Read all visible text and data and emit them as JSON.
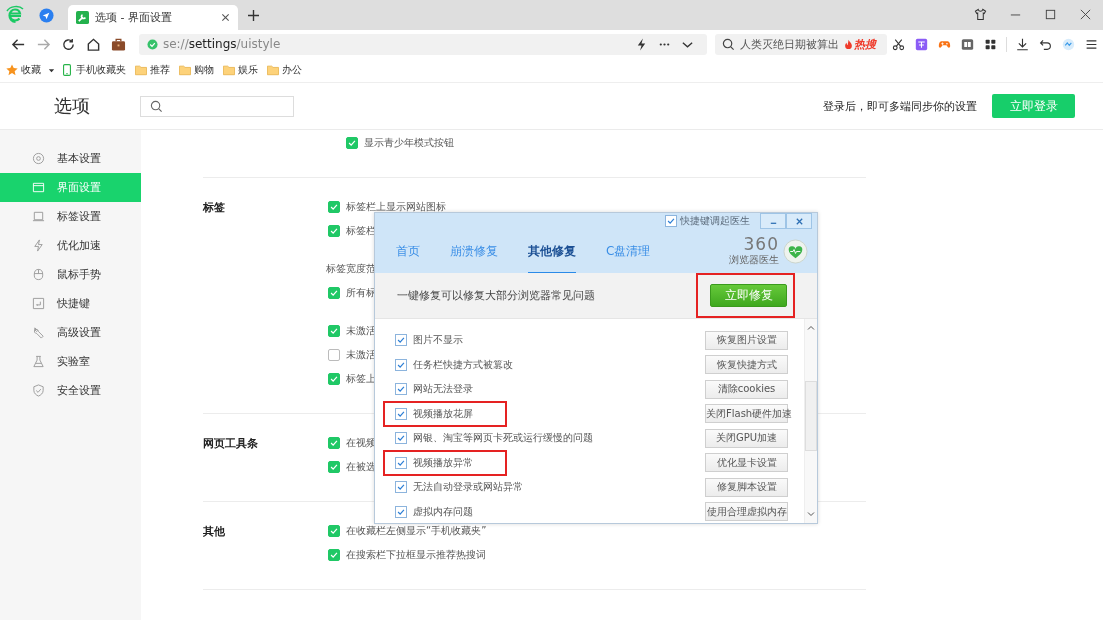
{
  "browser": {
    "tab_title": "选项 - 界面设置",
    "address": "se://**settings**/uistyle",
    "search": {
      "placeholder": "人类灭绝日期被算出",
      "hot_label": "热搜"
    },
    "bookmarks": [
      {
        "label": "收藏",
        "kind": "star"
      },
      {
        "label": "手机收藏夹",
        "kind": "phone"
      },
      {
        "label": "推荐",
        "kind": "folder"
      },
      {
        "label": "购物",
        "kind": "folder"
      },
      {
        "label": "娱乐",
        "kind": "folder"
      },
      {
        "label": "办公",
        "kind": "folder"
      }
    ]
  },
  "settings": {
    "title": "选项",
    "login_hint": "登录后，即可多端同步你的设置",
    "login_button": "立即登录"
  },
  "sidebar": {
    "items": [
      {
        "label": "基本设置",
        "selected": false
      },
      {
        "label": "界面设置",
        "selected": true
      },
      {
        "label": "标签设置",
        "selected": false
      },
      {
        "label": "优化加速",
        "selected": false
      },
      {
        "label": "鼠标手势",
        "selected": false
      },
      {
        "label": "快捷键",
        "selected": false
      },
      {
        "label": "高级设置",
        "selected": false
      },
      {
        "label": "实验室",
        "selected": false
      },
      {
        "label": "安全设置",
        "selected": false
      }
    ]
  },
  "sections": [
    {
      "groups": [
        {
          "rows": [
            {
              "kind": "checkbox",
              "label": "显示青少年模式按钮",
              "checked": true
            }
          ]
        }
      ]
    },
    {
      "heading": "标签",
      "groups": [
        {
          "rows": [
            {
              "kind": "checkbox",
              "label": "标签栏上显示网站图标",
              "checked": true
            },
            {
              "kind": "checkbox",
              "label": "标签栏",
              "checked": true
            }
          ]
        },
        {
          "rows": [
            {
              "kind": "text",
              "label": "标签宽度范"
            },
            {
              "kind": "checkbox",
              "label": "所有标",
              "checked": true
            }
          ]
        },
        {
          "rows": [
            {
              "kind": "checkbox",
              "label": "未激活",
              "checked": true
            },
            {
              "kind": "checkbox",
              "label": "未激活",
              "checked": false
            },
            {
              "kind": "checkbox",
              "label": "标签上",
              "checked": true
            }
          ]
        }
      ]
    },
    {
      "heading": "网页工具条",
      "groups": [
        {
          "rows": [
            {
              "kind": "checkbox",
              "label": "在视频",
              "checked": true
            },
            {
              "kind": "checkbox",
              "label": "在被选",
              "checked": true
            }
          ]
        }
      ]
    },
    {
      "heading": "其他",
      "groups": [
        {
          "rows": [
            {
              "kind": "checkbox",
              "label": "在收藏栏左侧显示“手机收藏夹”",
              "checked": true
            },
            {
              "kind": "checkbox",
              "label": "在搜索栏下拉框显示推荐热搜词",
              "checked": true
            }
          ]
        }
      ]
    }
  ],
  "dialog": {
    "shortcut_option": {
      "label": "快捷键调起医生",
      "checked": true
    },
    "tabs": [
      {
        "label": "首页",
        "selected": false
      },
      {
        "label": "崩溃修复",
        "selected": false
      },
      {
        "label": "其他修复",
        "selected": true
      },
      {
        "label": "C盘清理",
        "selected": false
      }
    ],
    "brand": "360",
    "brand_sub": "浏览器医生",
    "summary": "一键修复可以修复大部分浏览器常见问题",
    "repair_button": {
      "label": "立即修复",
      "highlighted": true
    },
    "items": [
      {
        "label": "图片不显示",
        "action": "恢复图片设置",
        "checked": true,
        "highlighted": false
      },
      {
        "label": "任务栏快捷方式被篡改",
        "action": "恢复快捷方式",
        "checked": true,
        "highlighted": false
      },
      {
        "label": "网站无法登录",
        "action": "清除cookies",
        "checked": true,
        "highlighted": false
      },
      {
        "label": "视频播放花屏",
        "action": "关闭Flash硬件加速",
        "checked": true,
        "highlighted": true
      },
      {
        "label": "网银、淘宝等网页卡死或运行缓慢的问题",
        "action": "关闭GPU加速",
        "checked": true,
        "highlighted": false
      },
      {
        "label": "视频播放异常",
        "action": "优化显卡设置",
        "checked": true,
        "highlighted": true
      },
      {
        "label": "无法自动登录或网站异常",
        "action": "修复脚本设置",
        "checked": true,
        "highlighted": false
      },
      {
        "label": "虚拟内存问题",
        "action": "使用合理虚拟内存",
        "checked": true,
        "highlighted": false
      }
    ]
  }
}
